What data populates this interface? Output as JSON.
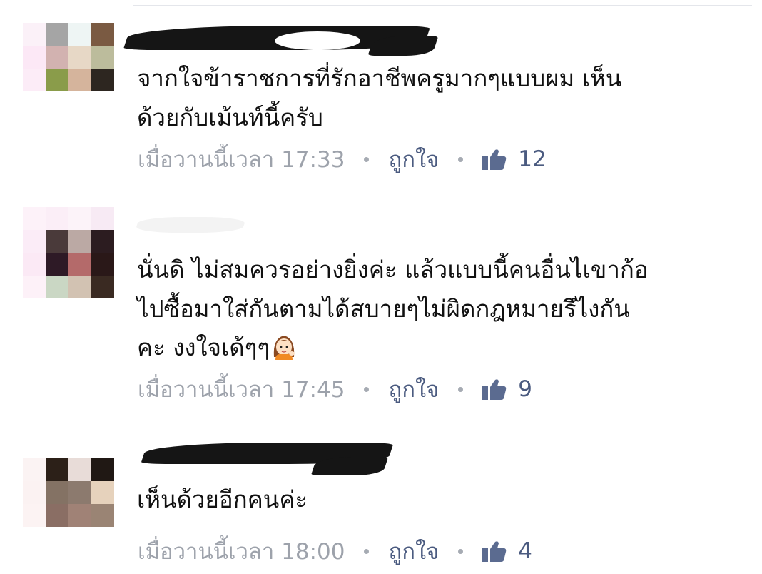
{
  "comments": [
    {
      "lines": [
        "จากใจข้าราชการที่รักอาชีพครูมากๆแบบผม เห็น",
        "ด้วยกับเม้นท์นี้ครับ"
      ],
      "time": "เมื่อวานนี้เวลา 17:33",
      "like_label": "ถูกใจ",
      "likes": "12",
      "avatar_colors": [
        "#fbf1f8",
        "#a5a5a5",
        "#eef5f4",
        "#7a5a42",
        "#fce8f6",
        "#d2b2b0",
        "#e7d8c6",
        "#bcbc9c",
        "#fcecf7",
        "#8a9c4a",
        "#d5b49c",
        "#2d2620",
        "#ffffff",
        "#ffffff",
        "#ffffff",
        "#ffffff"
      ]
    },
    {
      "lines": [
        "นั่นดิ ไม่สมควรอย่างยิ่งค่ะ แล้วแบบนี้คนอื่นไเขาก้อ",
        "ไปซื้อมาใส่กันตามได้สบายๆไม่ผิดกฎหมายรึไงกัน",
        "คะ  งงใจเด้ๆๆ"
      ],
      "time": "เมื่อวานนี้เวลา 17:45",
      "like_label": "ถูกใจ",
      "likes": "9",
      "avatar_colors": [
        "#fdf2f9",
        "#fbeef7",
        "#fcf3f9",
        "#f7eaf4",
        "#fbecf7",
        "#4a3a3a",
        "#bba9a4",
        "#2c1c20",
        "#fbe9f5",
        "#2e1a26",
        "#b46a6a",
        "#2a1818",
        "#fdf1f8",
        "#cad7c4",
        "#d2c2b2",
        "#3a2a22"
      ]
    },
    {
      "lines": [
        "เห็นด้วยอีกคนค่ะ"
      ],
      "time": "เมื่อวานนี้เวลา 18:00",
      "like_label": "ถูกใจ",
      "likes": "4",
      "avatar_colors": [
        "#ffffff",
        "#ffffff",
        "#ffffff",
        "#ffffff",
        "#fbf3f3",
        "#2c2018",
        "#e8dcd8",
        "#201814",
        "#fbf2f2",
        "#847264",
        "#8c7a6e",
        "#e6d2bc",
        "#fcf3f3",
        "#8a6e64",
        "#a08276",
        "#9a8474"
      ]
    }
  ],
  "colors": {
    "text": "#111111",
    "meta_gray": "#9da2ab",
    "link_blue": "#4b5b80"
  },
  "icons": {
    "like": "thumbs-up-icon",
    "emoji": "person-tipping-hand-emoji"
  }
}
